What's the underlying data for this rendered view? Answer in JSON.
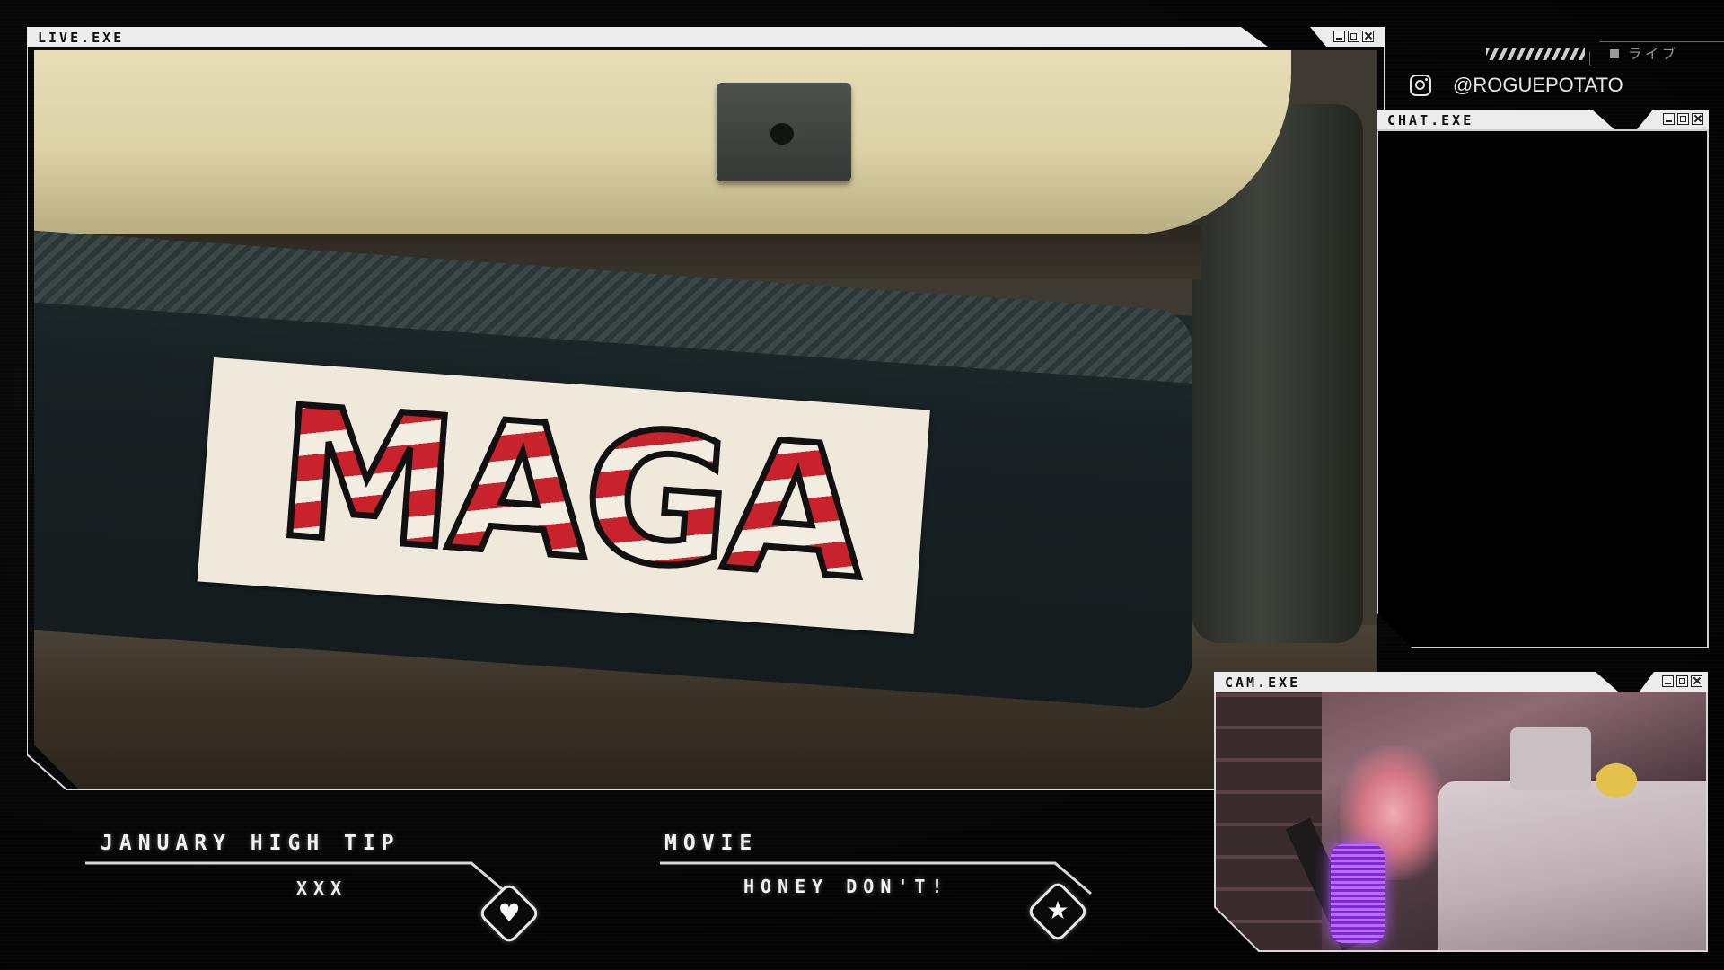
{
  "windows": {
    "live": {
      "title": "LIVE.EXE"
    },
    "chat": {
      "title": "CHAT.EXE"
    },
    "cam": {
      "title": "CAM.EXE"
    }
  },
  "stream": {
    "sticker_text": "MAGA"
  },
  "social": {
    "platform_icon": "instagram-icon",
    "handle": "@ROGUEPOTATO"
  },
  "live_tag": {
    "label": "ライブ"
  },
  "panels": {
    "tip": {
      "title": "JANUARY HIGH TIP",
      "value": "XXX",
      "icon": "heart-icon"
    },
    "movie": {
      "title": "MOVIE",
      "value": "HONEY DON'T!",
      "icon": "star-icon"
    }
  },
  "colors": {
    "background": "#050505",
    "frame": "#ececec",
    "accent_glow": "#b35bff"
  }
}
